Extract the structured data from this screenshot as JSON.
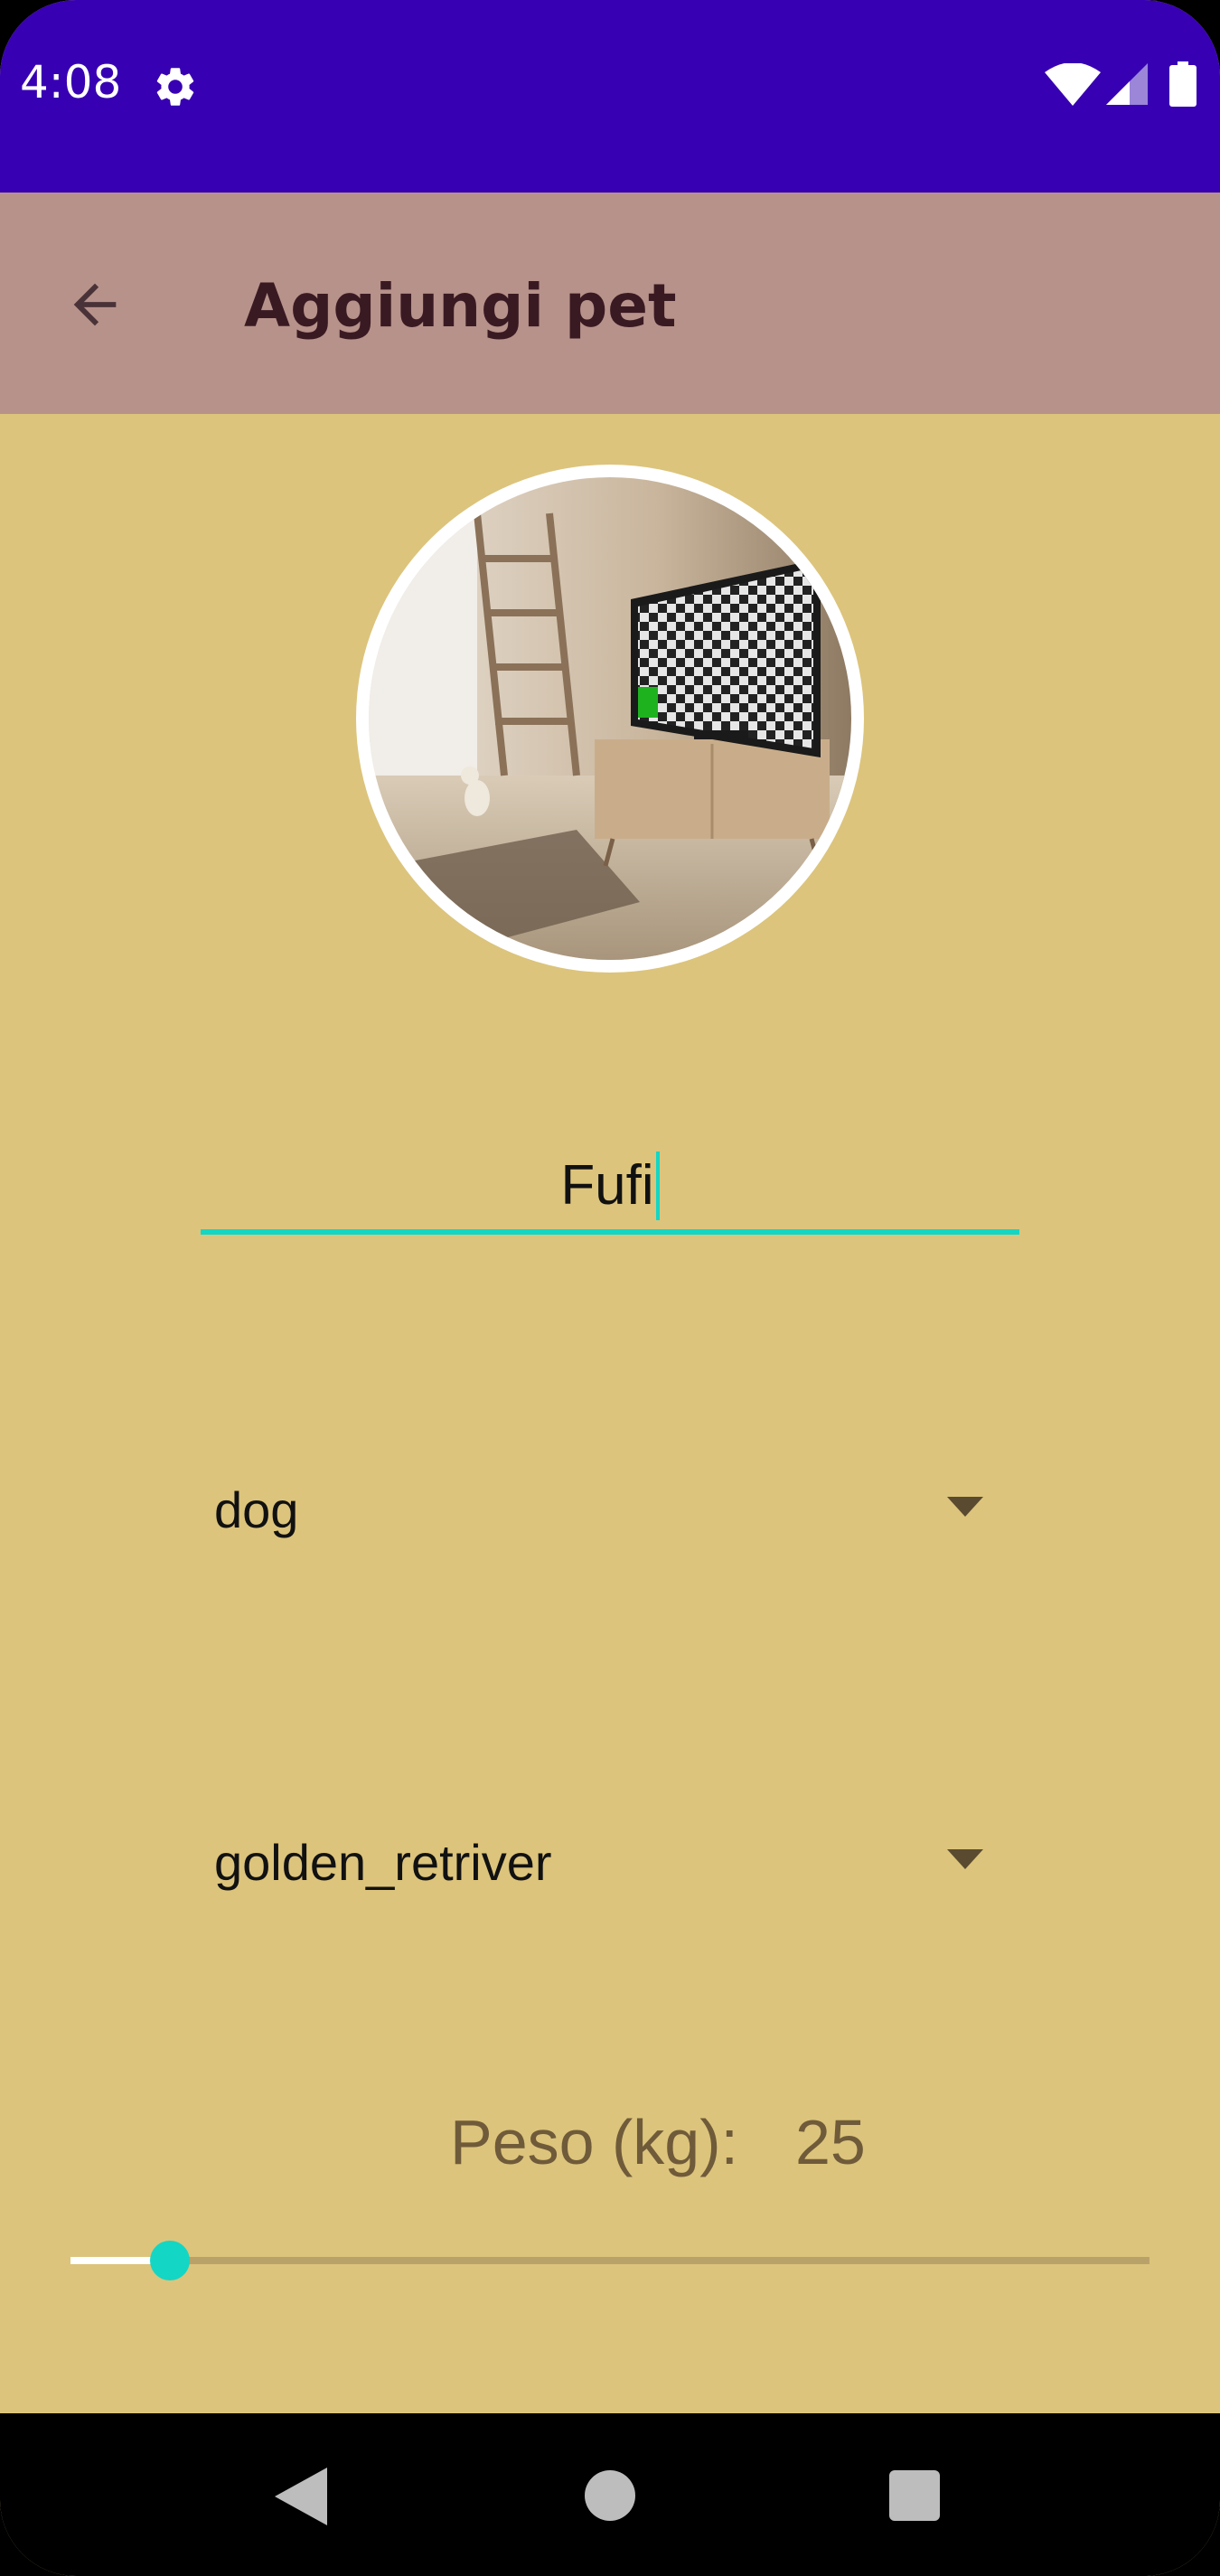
{
  "status_bar": {
    "time": "4:08",
    "icons": [
      "settings-icon",
      "wifi-icon",
      "cell-signal-icon",
      "battery-icon"
    ],
    "background": "#3700b3"
  },
  "toolbar": {
    "title": "Aggiungi pet",
    "back_icon": "arrow-back-icon",
    "background": "#b7928b"
  },
  "avatar": {
    "image": "photo of a room with a small dog sitting by a window and a TV on a cabinet"
  },
  "form": {
    "name": {
      "value": "Fufi"
    },
    "species": {
      "value": "dog"
    },
    "breed": {
      "value": "golden_retriver"
    },
    "weight": {
      "label": "Peso (kg):",
      "value": "25",
      "fraction": 0.092
    }
  },
  "colors": {
    "page_background": "#dcc47c",
    "accent": "#14d6c4"
  },
  "nav_bar": {
    "icons": [
      "nav-back-icon",
      "nav-home-icon",
      "nav-recents-icon"
    ]
  }
}
